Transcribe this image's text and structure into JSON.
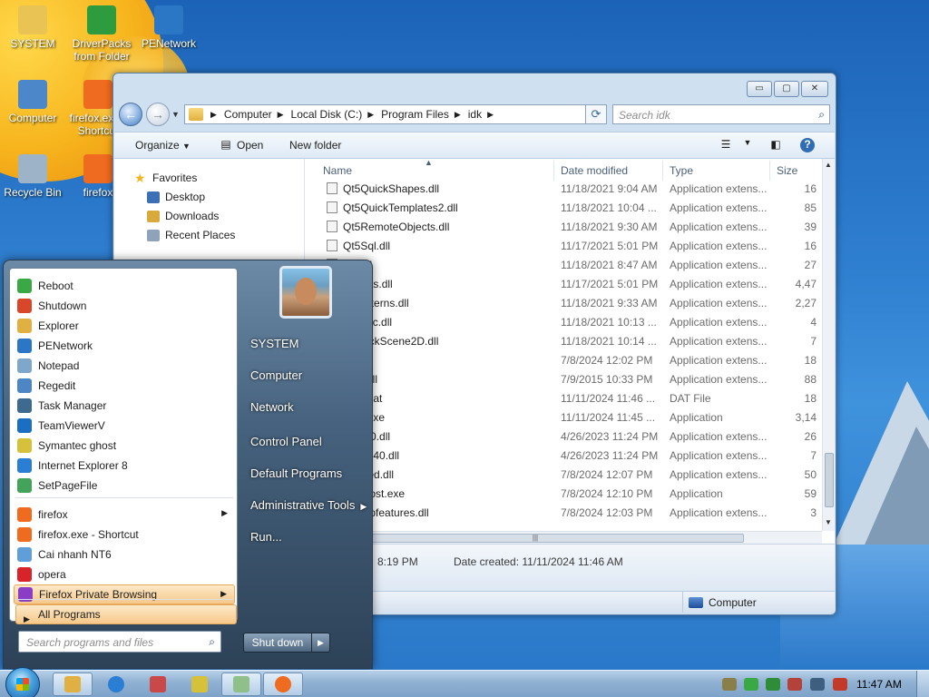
{
  "desktop": {
    "icons": [
      {
        "label": "SYSTEM",
        "icon": "user-folder-icon",
        "color": "#e9c354"
      },
      {
        "label": "DriverPacks from Folder",
        "icon": "driverpacks-icon",
        "color": "#2e9b3f"
      },
      {
        "label": "PENetwork",
        "icon": "network-globe-icon",
        "color": "#2b77c6"
      },
      {
        "label": "Computer",
        "icon": "computer-icon",
        "color": "#4c87c9"
      },
      {
        "label": "firefox.exe - Shortcut",
        "icon": "firefox-icon",
        "color": "#ef6b1f"
      },
      {
        "label": "Recycle Bin",
        "icon": "recycle-bin-icon",
        "color": "#9cb3c8"
      },
      {
        "label": "firefox",
        "icon": "firefox-icon",
        "color": "#ef6b1f"
      }
    ]
  },
  "explorer": {
    "controls": {
      "minimize": "▭",
      "maximize": "▢",
      "close": "✕"
    },
    "address": {
      "crumbs": [
        "Computer",
        "Local Disk (C:)",
        "Program Files",
        "idk"
      ],
      "separator": "▶"
    },
    "search_placeholder": "Search idk",
    "toolbar": {
      "organize": "Organize",
      "open": "Open",
      "new_folder": "New folder"
    },
    "nav_pane": [
      {
        "label": "Favorites",
        "icon": "star-icon",
        "color": "#f2b51c"
      },
      {
        "label": "Desktop",
        "icon": "desktop-icon",
        "color": "#3d6fb4"
      },
      {
        "label": "Downloads",
        "icon": "downloads-folder-icon",
        "color": "#d8a93b"
      },
      {
        "label": "Recent Places",
        "icon": "recent-places-icon",
        "color": "#8ea3b8"
      }
    ],
    "columns": {
      "name": "Name",
      "date": "Date modified",
      "type": "Type",
      "size": "Size"
    },
    "files": [
      {
        "name": "Qt5QuickShapes.dll",
        "date": "11/18/2021 9:04 AM",
        "type": "Application extens...",
        "size": "16"
      },
      {
        "name": "Qt5QuickTemplates2.dll",
        "date": "11/18/2021 10:04 ...",
        "type": "Application extens...",
        "size": "85"
      },
      {
        "name": "Qt5RemoteObjects.dll",
        "date": "11/18/2021 9:30 AM",
        "type": "Application extens...",
        "size": "39"
      },
      {
        "name": "Qt5Sql.dll",
        "date": "11/17/2021 5:01 PM",
        "type": "Application extens...",
        "size": "16"
      },
      {
        "name": "...g.dll",
        "date": "11/18/2021 8:47 AM",
        "type": "Application extens...",
        "size": "27"
      },
      {
        "name": "...dgets.dll",
        "date": "11/17/2021 5:01 PM",
        "type": "Application extens...",
        "size": "4,47"
      },
      {
        "name": "...lPatterns.dll",
        "date": "11/18/2021 9:33 AM",
        "type": "Application extens...",
        "size": "2,27"
      },
      {
        "name": "...Logic.dll",
        "date": "11/18/2021 10:13 ...",
        "type": "Application extens...",
        "size": "4"
      },
      {
        "name": "...QuickScene2D.dll",
        "date": "11/18/2021 10:14 ...",
        "type": "Application extens...",
        "size": "7"
      },
      {
        "name": "...dll",
        "date": "7/8/2024 12:02 PM",
        "type": "Application extens...",
        "size": "18"
      },
      {
        "name": "...se.dll",
        "date": "7/9/2015 10:33 PM",
        "type": "Application extens...",
        "size": "88"
      },
      {
        "name": "...00.dat",
        "date": "11/11/2024 11:46 ...",
        "type": "DAT File",
        "size": "18"
      },
      {
        "name": "...00.exe",
        "date": "11/11/2024 11:45 ...",
        "type": "Application",
        "size": "3,14"
      },
      {
        "name": "...b140.dll",
        "date": "4/26/2023 11:24 PM",
        "type": "Application extens...",
        "size": "26"
      },
      {
        "name": "...me140.dll",
        "date": "4/26/2023 11:24 PM",
        "type": "Application extens...",
        "size": "7"
      },
      {
        "name": "...hared.dll",
        "date": "7/8/2024 12:07 PM",
        "type": "Application extens...",
        "size": "50"
      },
      {
        "name": "...vehost.exe",
        "date": "7/8/2024 12:10 PM",
        "type": "Application",
        "size": "59"
      },
      {
        "name": "...vappfeatures.dll",
        "date": "7/8/2024 12:03 PM",
        "type": "Application extens...",
        "size": "3"
      }
    ],
    "details": {
      "modified_time": "8:19 PM",
      "date_created": "Date created: 11/11/2024 11:46 AM"
    },
    "status_location": "Computer"
  },
  "start_menu": {
    "left_items": [
      {
        "label": "Reboot",
        "icon": "reboot-icon",
        "color": "#3aa845",
        "arrow": false,
        "highlight": false
      },
      {
        "label": "Shutdown",
        "icon": "shutdown-icon",
        "color": "#d9472b",
        "arrow": false,
        "highlight": false
      },
      {
        "label": "Explorer",
        "icon": "explorer-icon",
        "color": "#e0b043",
        "arrow": false,
        "highlight": false
      },
      {
        "label": "PENetwork",
        "icon": "network-globe-icon",
        "color": "#2b77c6",
        "arrow": false,
        "highlight": false
      },
      {
        "label": "Notepad",
        "icon": "notepad-icon",
        "color": "#7ea7c9",
        "arrow": false,
        "highlight": false
      },
      {
        "label": "Regedit",
        "icon": "regedit-icon",
        "color": "#4d86c4",
        "arrow": false,
        "highlight": false
      },
      {
        "label": "Task Manager",
        "icon": "task-manager-icon",
        "color": "#3f6a8f",
        "arrow": false,
        "highlight": false
      },
      {
        "label": "TeamViewerV",
        "icon": "teamviewer-icon",
        "color": "#1b6ec2",
        "arrow": false,
        "highlight": false
      },
      {
        "label": "Symantec ghost",
        "icon": "ghost-icon",
        "color": "#d6c23a",
        "arrow": false,
        "highlight": false
      },
      {
        "label": "Internet Explorer 8",
        "icon": "internet-explorer-icon",
        "color": "#2a7fd4",
        "arrow": false,
        "highlight": false
      },
      {
        "label": "SetPageFile",
        "icon": "setpagefile-icon",
        "color": "#43a35a",
        "arrow": false,
        "highlight": false
      },
      {
        "label": "firefox",
        "icon": "firefox-icon",
        "color": "#ef6b1f",
        "arrow": true,
        "highlight": false
      },
      {
        "label": "firefox.exe - Shortcut",
        "icon": "firefox-icon",
        "color": "#ef6b1f",
        "arrow": false,
        "highlight": false
      },
      {
        "label": "Cai nhanh NT6",
        "icon": "installer-icon",
        "color": "#5f9ed8",
        "arrow": false,
        "highlight": false
      },
      {
        "label": "opera",
        "icon": "opera-icon",
        "color": "#d8232a",
        "arrow": false,
        "highlight": false
      },
      {
        "label": "Firefox Private Browsing",
        "icon": "private-browsing-icon",
        "color": "#8a3ec6",
        "arrow": true,
        "highlight": true
      }
    ],
    "all_programs": "All Programs",
    "search_placeholder": "Search programs and files",
    "right_items": [
      {
        "label": "SYSTEM",
        "arrow": false
      },
      {
        "label": "Computer",
        "arrow": false
      },
      {
        "label": "Network",
        "arrow": false
      },
      {
        "label": "Control Panel",
        "arrow": false
      },
      {
        "label": "Default Programs",
        "arrow": false
      },
      {
        "label": "Administrative Tools",
        "arrow": true
      },
      {
        "label": "Run...",
        "arrow": false
      }
    ],
    "shutdown_label": "Shut down",
    "shutdown_arrow": "▶"
  },
  "taskbar": {
    "pinned": [
      {
        "icon": "explorer-folder-icon",
        "color": "#e0b043",
        "active": true
      },
      {
        "icon": "internet-explorer-icon",
        "color": "#2a7fd4",
        "active": false
      },
      {
        "icon": "network-tool-icon",
        "color": "#c94848",
        "active": false
      },
      {
        "icon": "ghost-icon",
        "color": "#d6c23a",
        "active": false
      },
      {
        "icon": "notepad-icon",
        "color": "#8fc08a",
        "active": true
      },
      {
        "icon": "firefox-icon",
        "color": "#ef6b1f",
        "active": true
      }
    ],
    "tray": [
      {
        "icon": "tray-tools-icon",
        "color": "#8a7f4a"
      },
      {
        "icon": "tray-shield-check-icon",
        "color": "#3aa845"
      },
      {
        "icon": "tray-play-icon",
        "color": "#2f8d3a"
      },
      {
        "icon": "tray-registry-icon",
        "color": "#b3433a"
      },
      {
        "icon": "tray-monitor-icon",
        "color": "#3f5f80"
      },
      {
        "icon": "tray-volume-muted-icon",
        "color": "#c23a2a"
      }
    ],
    "clock": "11:47 AM"
  }
}
